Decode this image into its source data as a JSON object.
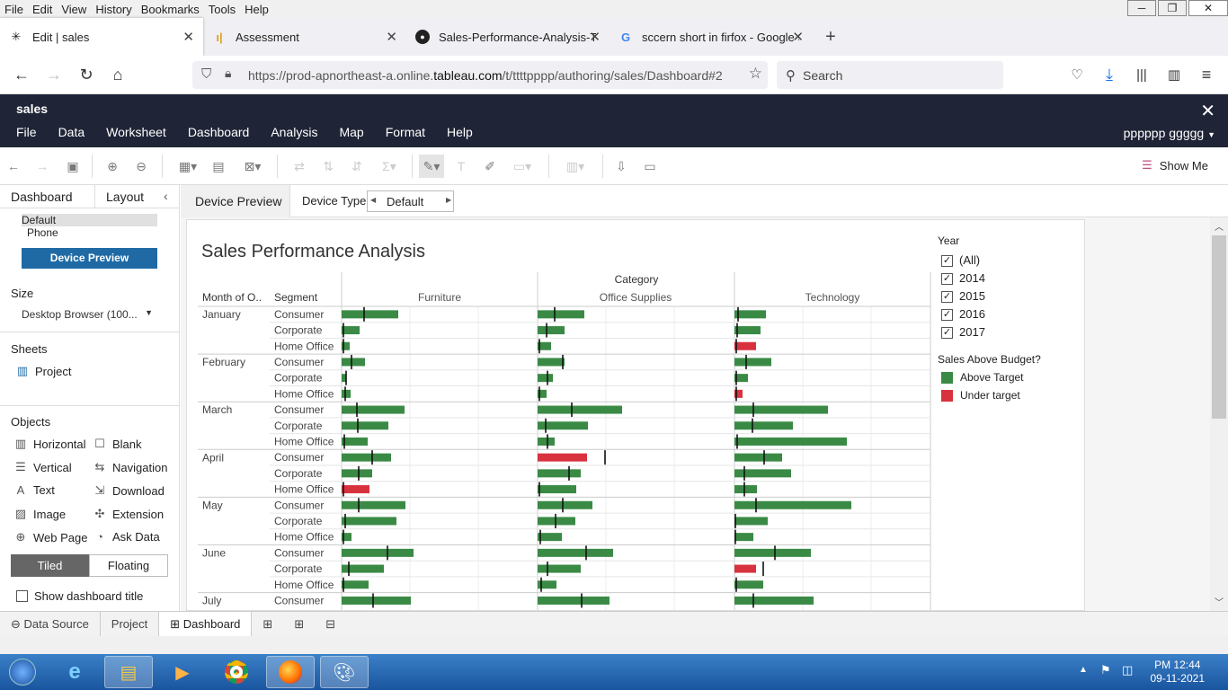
{
  "menubar": {
    "items": [
      "File",
      "Edit",
      "View",
      "History",
      "Bookmarks",
      "Tools",
      "Help"
    ]
  },
  "tabs": [
    {
      "title": "Edit | sales",
      "icon": "tableau-icon"
    },
    {
      "title": "Assessment",
      "icon": "bar-icon"
    },
    {
      "title": "Sales-Performance-Analysis-Tal",
      "icon": "github-icon"
    },
    {
      "title": "sccern short in firfox - Google Sc",
      "icon": "google-icon"
    }
  ],
  "nav": {
    "url_prefix": "https://prod-apnortheast-a.online.",
    "url_domain": "tableau.com",
    "url_path": "/t/ttttpppp/authoring/sales/Dashboard#2",
    "search_placeholder": "Search"
  },
  "app": {
    "workbook": "sales",
    "menu": [
      "File",
      "Data",
      "Worksheet",
      "Dashboard",
      "Analysis",
      "Map",
      "Format",
      "Help"
    ],
    "user": "pppppp ggggg"
  },
  "toolbar": {
    "show_me": "Show Me"
  },
  "left": {
    "tab_dashboard": "Dashboard",
    "tab_layout": "Layout",
    "devices": [
      "Default",
      "Phone"
    ],
    "device_preview": "Device Preview",
    "size_label": "Size",
    "size_value": "Desktop Browser (100...",
    "sheets_label": "Sheets",
    "sheet": "Project",
    "objects_label": "Objects",
    "objects": [
      "Horizontal",
      "Blank",
      "Vertical",
      "Navigation",
      "Text",
      "Download",
      "Image",
      "Extension",
      "Web Page",
      "Ask Data"
    ],
    "tiled": "Tiled",
    "floating": "Floating",
    "show_title": "Show dashboard title"
  },
  "devicebar": {
    "preview": "Device Preview",
    "device_type_label": "Device Type",
    "device_type": "Default"
  },
  "dashboard": {
    "title": "Sales Performance Analysis",
    "category_header": "Category",
    "month_header": "Month of O..",
    "segment_header": "Segment",
    "categories": [
      "Furniture",
      "Office Supplies",
      "Technology"
    ],
    "months": [
      "January",
      "February",
      "March",
      "April",
      "May",
      "June",
      "July"
    ],
    "segments": [
      "Consumer",
      "Corporate",
      "Home Office"
    ]
  },
  "legend": {
    "year_title": "Year",
    "years": [
      "(All)",
      "2014",
      "2015",
      "2016",
      "2017"
    ],
    "budget_title": "Sales Above Budget?",
    "above": "Above Target",
    "under": "Under target",
    "above_color": "#3a8a45",
    "under_color": "#d9323f"
  },
  "chart_data": {
    "type": "bar",
    "title": "Sales Performance Analysis",
    "rows": [
      {
        "month": "January",
        "segment": "Consumer",
        "values": [
          63,
          52,
          35
        ],
        "targets": [
          25,
          19,
          4
        ],
        "flags": [
          1,
          1,
          1
        ]
      },
      {
        "month": "January",
        "segment": "Corporate",
        "values": [
          20,
          30,
          29
        ],
        "targets": [
          2,
          10,
          3
        ],
        "flags": [
          1,
          1,
          1
        ]
      },
      {
        "month": "January",
        "segment": "Home Office",
        "values": [
          9,
          15,
          24
        ],
        "targets": [
          2,
          2,
          2
        ],
        "flags": [
          1,
          1,
          0
        ]
      },
      {
        "month": "February",
        "segment": "Consumer",
        "values": [
          26,
          30,
          41
        ],
        "targets": [
          11,
          28,
          13
        ],
        "flags": [
          1,
          1,
          1
        ]
      },
      {
        "month": "February",
        "segment": "Corporate",
        "values": [
          5,
          17,
          15
        ],
        "targets": [
          5,
          11,
          2
        ],
        "flags": [
          1,
          1,
          1
        ]
      },
      {
        "month": "February",
        "segment": "Home Office",
        "values": [
          10,
          10,
          9
        ],
        "targets": [
          4,
          2,
          2
        ],
        "flags": [
          1,
          1,
          0
        ]
      },
      {
        "month": "March",
        "segment": "Consumer",
        "values": [
          70,
          94,
          104
        ],
        "targets": [
          17,
          38,
          21
        ],
        "flags": [
          1,
          1,
          1
        ]
      },
      {
        "month": "March",
        "segment": "Corporate",
        "values": [
          52,
          56,
          65
        ],
        "targets": [
          18,
          9,
          20
        ],
        "flags": [
          1,
          1,
          1
        ]
      },
      {
        "month": "March",
        "segment": "Home Office",
        "values": [
          29,
          19,
          125
        ],
        "targets": [
          3,
          11,
          3
        ],
        "flags": [
          1,
          1,
          1
        ]
      },
      {
        "month": "April",
        "segment": "Consumer",
        "values": [
          55,
          55,
          53
        ],
        "targets": [
          34,
          75,
          33
        ],
        "flags": [
          1,
          0,
          1
        ]
      },
      {
        "month": "April",
        "segment": "Corporate",
        "values": [
          34,
          48,
          63
        ],
        "targets": [
          19,
          35,
          11
        ],
        "flags": [
          1,
          1,
          1
        ]
      },
      {
        "month": "April",
        "segment": "Home Office",
        "values": [
          31,
          43,
          25
        ],
        "targets": [
          2,
          2,
          11
        ],
        "flags": [
          0,
          1,
          1
        ]
      },
      {
        "month": "May",
        "segment": "Consumer",
        "values": [
          71,
          61,
          130
        ],
        "targets": [
          19,
          28,
          24
        ],
        "flags": [
          1,
          1,
          1
        ]
      },
      {
        "month": "May",
        "segment": "Corporate",
        "values": [
          61,
          42,
          37
        ],
        "targets": [
          4,
          20,
          1
        ],
        "flags": [
          1,
          1,
          1
        ]
      },
      {
        "month": "May",
        "segment": "Home Office",
        "values": [
          11,
          27,
          21
        ],
        "targets": [
          2,
          3,
          1
        ],
        "flags": [
          1,
          1,
          1
        ]
      },
      {
        "month": "June",
        "segment": "Consumer",
        "values": [
          80,
          84,
          85
        ],
        "targets": [
          51,
          54,
          45
        ],
        "flags": [
          1,
          1,
          1
        ]
      },
      {
        "month": "June",
        "segment": "Corporate",
        "values": [
          47,
          48,
          24
        ],
        "targets": [
          8,
          11,
          32
        ],
        "flags": [
          1,
          1,
          0
        ]
      },
      {
        "month": "June",
        "segment": "Home Office",
        "values": [
          30,
          21,
          32
        ],
        "targets": [
          2,
          4,
          2
        ],
        "flags": [
          1,
          1,
          1
        ]
      },
      {
        "month": "July",
        "segment": "Consumer",
        "values": [
          77,
          80,
          88
        ],
        "targets": [
          35,
          49,
          21
        ],
        "flags": [
          1,
          1,
          1
        ]
      }
    ]
  },
  "bottom": {
    "tabs": [
      "Data Source",
      "Project",
      "Dashboard"
    ]
  },
  "taskbar": {
    "time": "PM 12:44",
    "date": "09-11-2021"
  }
}
